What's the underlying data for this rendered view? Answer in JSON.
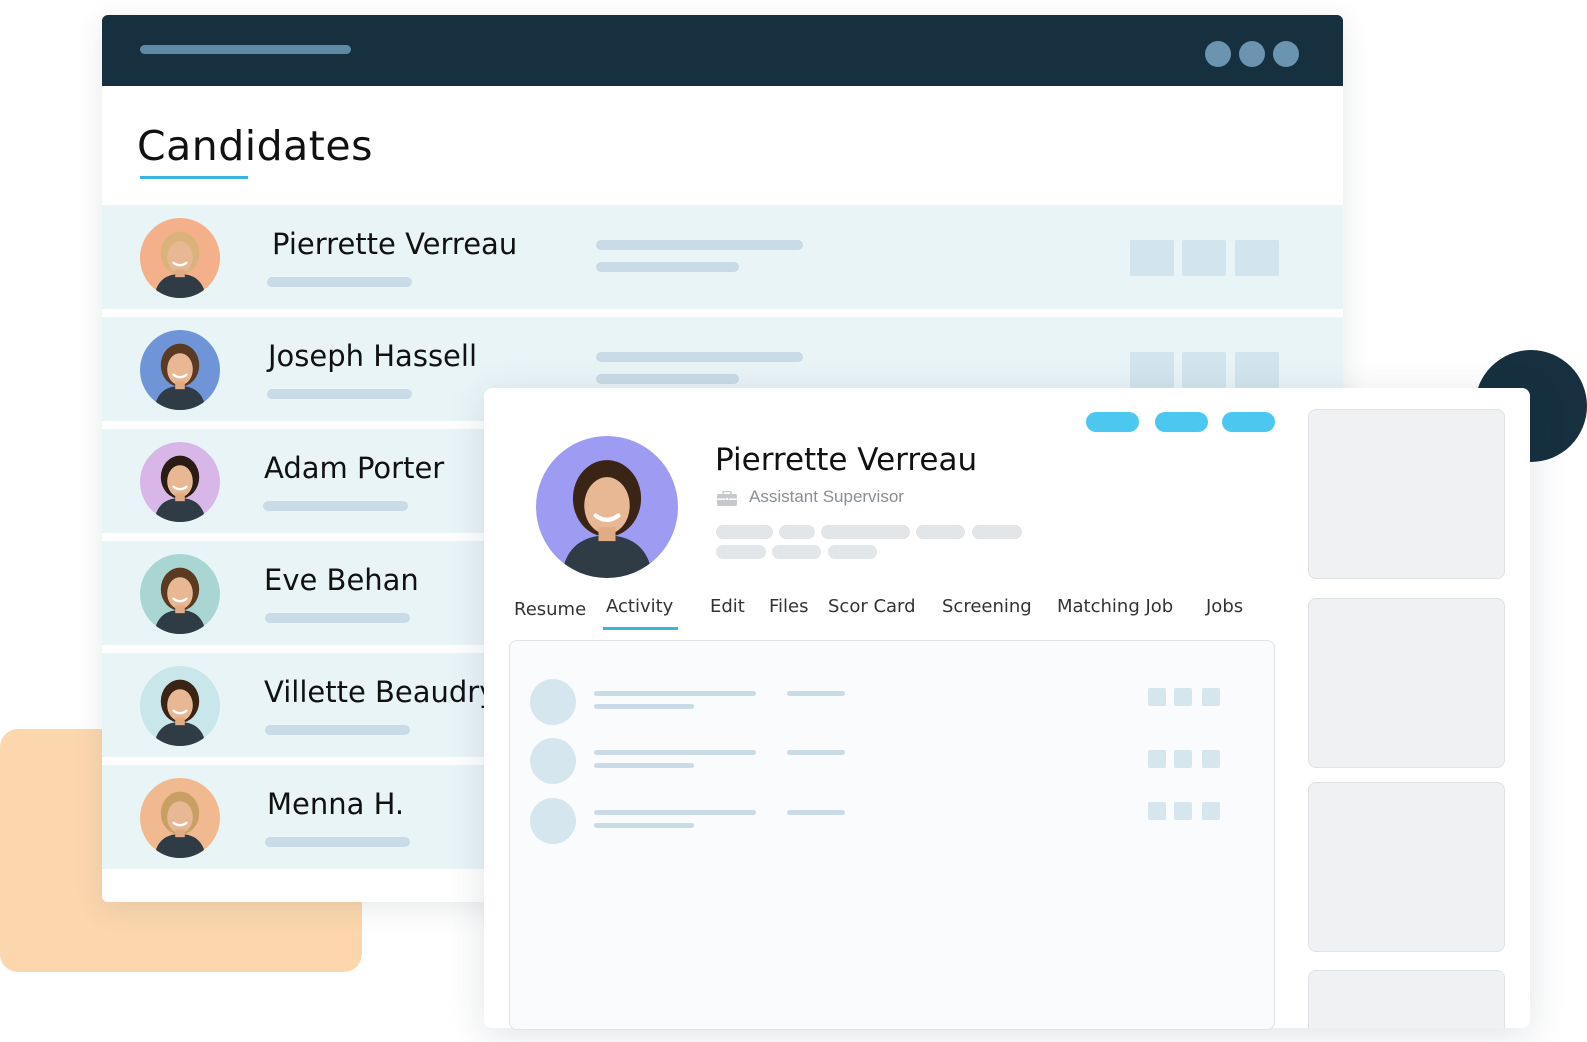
{
  "candidates": {
    "title": "Candidates",
    "rows": [
      {
        "name": "Pierrette Verreau",
        "avatar_color": "#f3b08a",
        "hair": "#d9b37a"
      },
      {
        "name": "Joseph Hassell",
        "avatar_color": "#6f95d8",
        "hair": "#5a3a22"
      },
      {
        "name": "Adam Porter",
        "avatar_color": "#d8b7e8",
        "hair": "#2a1c14"
      },
      {
        "name": "Eve Behan",
        "avatar_color": "#a9d6d3",
        "hair": "#5b3a22"
      },
      {
        "name": "Villette Beaudry",
        "avatar_color": "#c9e6ea",
        "hair": "#3a2416"
      },
      {
        "name": "Menna H.",
        "avatar_color": "#f1b98f",
        "hair": "#c9a064"
      }
    ]
  },
  "profile": {
    "name": "Pierrette Verreau",
    "role": "Assistant Supervisor",
    "avatar_color": "#9e9cf2",
    "hair": "#3a2416",
    "tabs": [
      {
        "label": "Resume",
        "active": false
      },
      {
        "label": "Activity",
        "active": true
      },
      {
        "label": "Edit",
        "active": false
      },
      {
        "label": "Files",
        "active": false
      },
      {
        "label": "Scor Card",
        "active": false
      },
      {
        "label": "Screening",
        "active": false
      },
      {
        "label": "Matching Job",
        "active": false
      },
      {
        "label": "Jobs",
        "active": false
      }
    ]
  },
  "colors": {
    "navy": "#16303f",
    "accent": "#3bb4e3",
    "pill": "#4cc8f0",
    "row_bg": "#e9f4f7",
    "peach": "#fcd7ae"
  }
}
